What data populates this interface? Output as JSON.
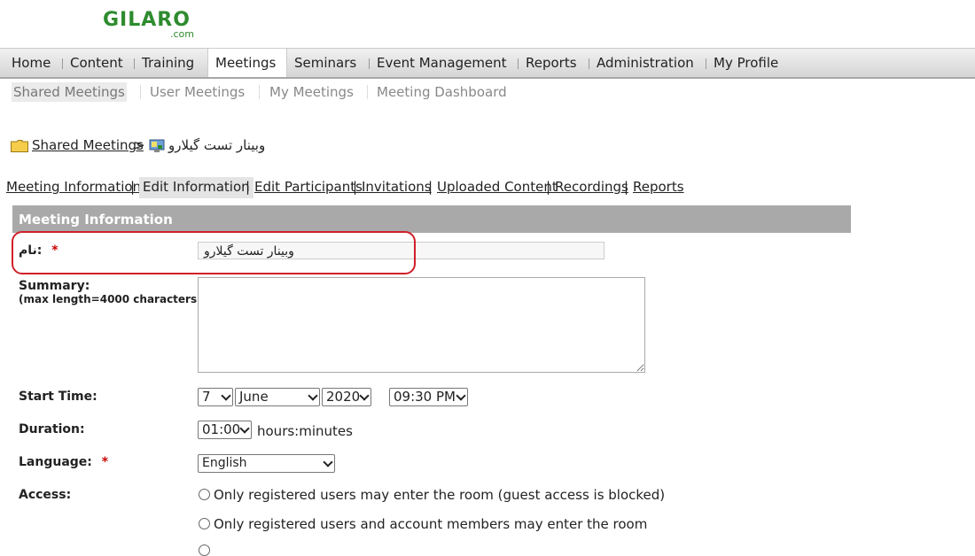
{
  "logo": {
    "brand": "GILARO",
    "suffix": ".com"
  },
  "nav": {
    "items": [
      "Home",
      "Content",
      "Training",
      "Meetings",
      "Seminars",
      "Event Management",
      "Reports",
      "Administration",
      "My Profile"
    ],
    "active": "Meetings"
  },
  "subnav": {
    "items": [
      "Shared Meetings",
      "User Meetings",
      "My Meetings",
      "Meeting Dashboard"
    ],
    "active": "Shared Meetings"
  },
  "breadcrumb": {
    "link": "Shared Meetings",
    "separator": ">",
    "current": "وبینار تست گیلارو"
  },
  "tabs": {
    "items": [
      "Meeting Information",
      "Edit Information",
      "Edit Participants",
      "Invitations",
      "Uploaded Content",
      "Recordings",
      "Reports"
    ],
    "active": "Edit Information"
  },
  "section": {
    "title": "Meeting Information"
  },
  "form": {
    "name_label": "نام:",
    "required_mark": "*",
    "name_value": "وبینار تست گیلارو",
    "summary_label": "Summary:",
    "summary_note": "(max length=4000 characters)",
    "start_label": "Start Time:",
    "start_day": "7",
    "start_month": "June",
    "start_year": "2020",
    "start_time": "09:30 PM",
    "duration_label": "Duration:",
    "duration_value": "01:00",
    "duration_unit": "hours:minutes",
    "language_label": "Language:",
    "language_value": "English",
    "access_label": "Access:",
    "access_option_1": "Only registered users may enter the room (guest access is blocked)",
    "access_option_2": "Only registered users and account members may enter the room"
  },
  "colors": {
    "brand": "#2e8b2e",
    "section_header": "#a9a9a9",
    "required": "#cc0000",
    "highlight": "#d0202a"
  }
}
